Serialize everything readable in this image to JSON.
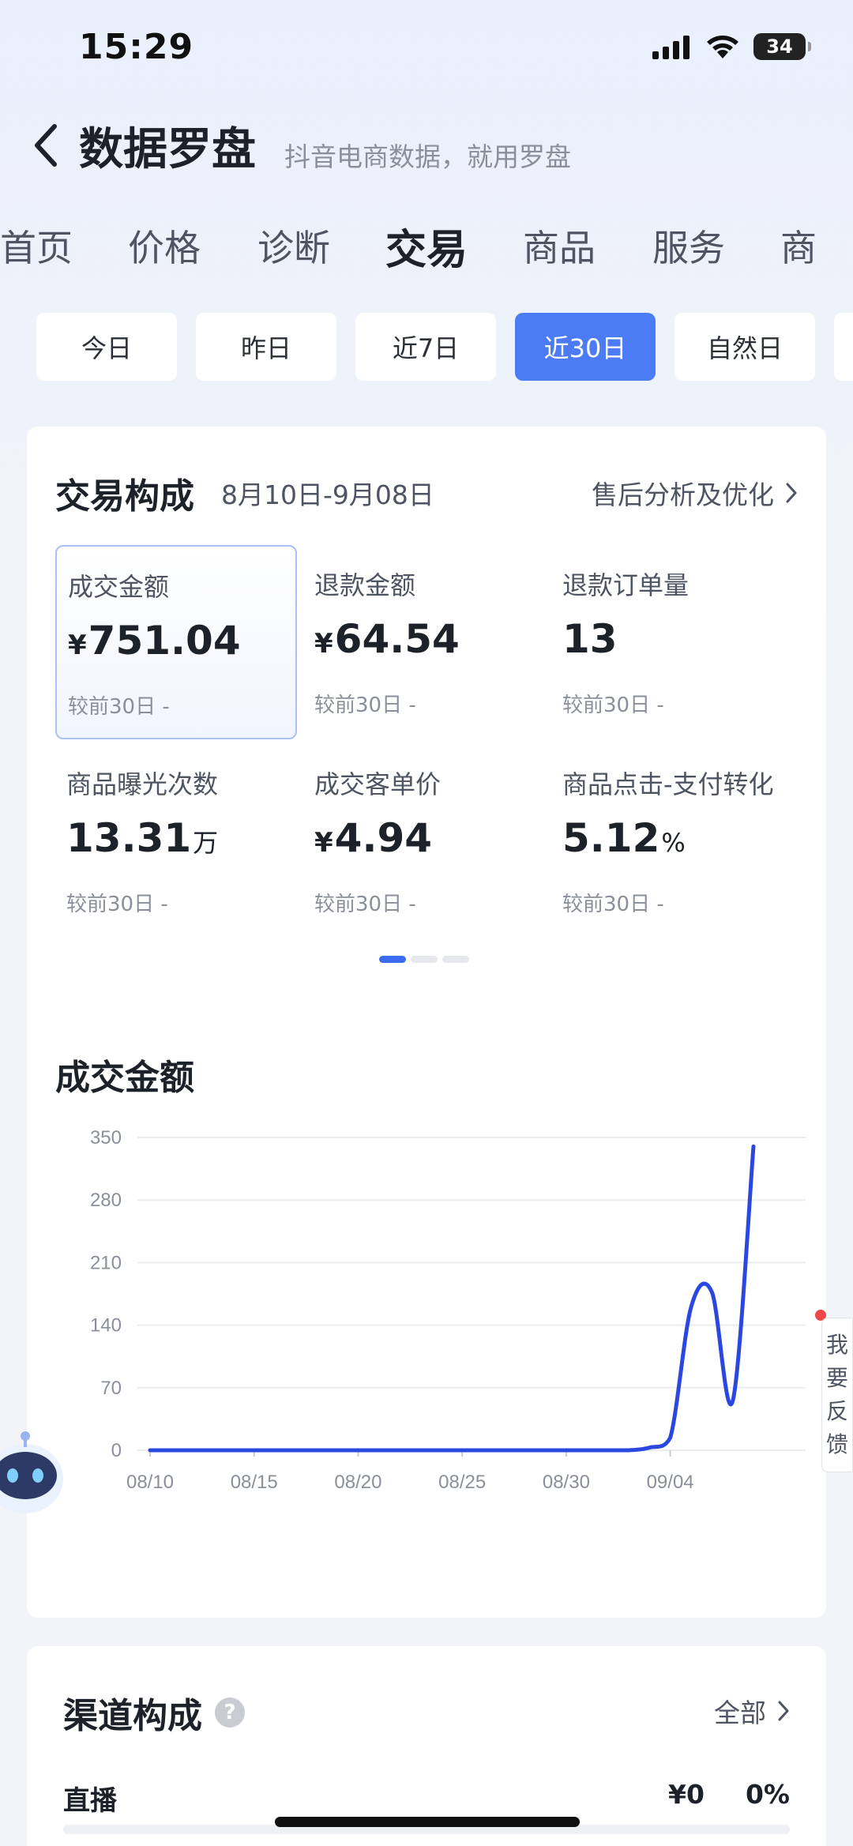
{
  "status_bar": {
    "time": "15:29",
    "battery": "34"
  },
  "header": {
    "title": "数据罗盘",
    "subtitle": "抖音电商数据，就用罗盘"
  },
  "top_tabs": [
    {
      "label": "首页"
    },
    {
      "label": "价格"
    },
    {
      "label": "诊断"
    },
    {
      "label": "交易",
      "active": true
    },
    {
      "label": "商品"
    },
    {
      "label": "服务"
    },
    {
      "label": "商"
    }
  ],
  "period_chips": [
    {
      "label": "今日"
    },
    {
      "label": "昨日"
    },
    {
      "label": "近7日"
    },
    {
      "label": "近30日",
      "active": true
    },
    {
      "label": "自然日"
    }
  ],
  "trade_card": {
    "title": "交易构成",
    "date_range": "8月10日-9月08日",
    "link": "售后分析及优化",
    "metrics": [
      {
        "label": "成交金额",
        "currency": "¥",
        "value": "751.04",
        "unit": "",
        "compare": "较前30日 -",
        "selected": true
      },
      {
        "label": "退款金额",
        "currency": "¥",
        "value": "64.54",
        "unit": "",
        "compare": "较前30日 -"
      },
      {
        "label": "退款订单量",
        "currency": "",
        "value": "13",
        "unit": "",
        "compare": "较前30日 -"
      },
      {
        "label": "商品曝光次数",
        "currency": "",
        "value": "13.31",
        "unit": "万",
        "compare": "较前30日 -"
      },
      {
        "label": "成交客单价",
        "currency": "¥",
        "value": "4.94",
        "unit": "",
        "compare": "较前30日 -"
      },
      {
        "label": "商品点击-支付转化",
        "currency": "",
        "value": "5.12",
        "unit": "%",
        "compare": "较前30日 -"
      }
    ],
    "pager": {
      "pages": 3,
      "active": 0
    }
  },
  "chart_title": "成交金额",
  "chart_data": {
    "type": "line",
    "title": "成交金额",
    "xlabel": "",
    "ylabel": "",
    "ylim": [
      0,
      350
    ],
    "yticks": [
      "0",
      "70",
      "140",
      "210",
      "280",
      "350"
    ],
    "xticks": [
      "08/10",
      "08/15",
      "08/20",
      "08/25",
      "08/30",
      "09/04"
    ],
    "x": [
      "08/10",
      "08/11",
      "08/12",
      "08/13",
      "08/14",
      "08/15",
      "08/16",
      "08/17",
      "08/18",
      "08/19",
      "08/20",
      "08/21",
      "08/22",
      "08/23",
      "08/24",
      "08/25",
      "08/26",
      "08/27",
      "08/28",
      "08/29",
      "08/30",
      "08/31",
      "09/01",
      "09/02",
      "09/03",
      "09/04",
      "09/05",
      "09/06",
      "09/07",
      "09/08"
    ],
    "series": [
      {
        "name": "",
        "color": "#2a48e0",
        "values": [
          0,
          0,
          0,
          0,
          0,
          0,
          0,
          0,
          0,
          0,
          0,
          0,
          0,
          0,
          0,
          0,
          0,
          0,
          0,
          0,
          0,
          0,
          0,
          0,
          3,
          14,
          160,
          177,
          55,
          340
        ]
      }
    ],
    "grid": true,
    "legend": "none"
  },
  "feedback": {
    "chars": [
      "我",
      "要",
      "反",
      "馈"
    ]
  },
  "channel_card": {
    "title": "渠道构成",
    "link": "全部",
    "rows": [
      {
        "label": "直播",
        "amount": "¥0",
        "percent": "0%"
      }
    ]
  },
  "icons": {
    "back": "chevron-left-icon",
    "link": "chevron-right-icon",
    "help": "question-icon"
  },
  "colors": {
    "accent": "#4b7cf5",
    "line": "#2a48e0"
  }
}
